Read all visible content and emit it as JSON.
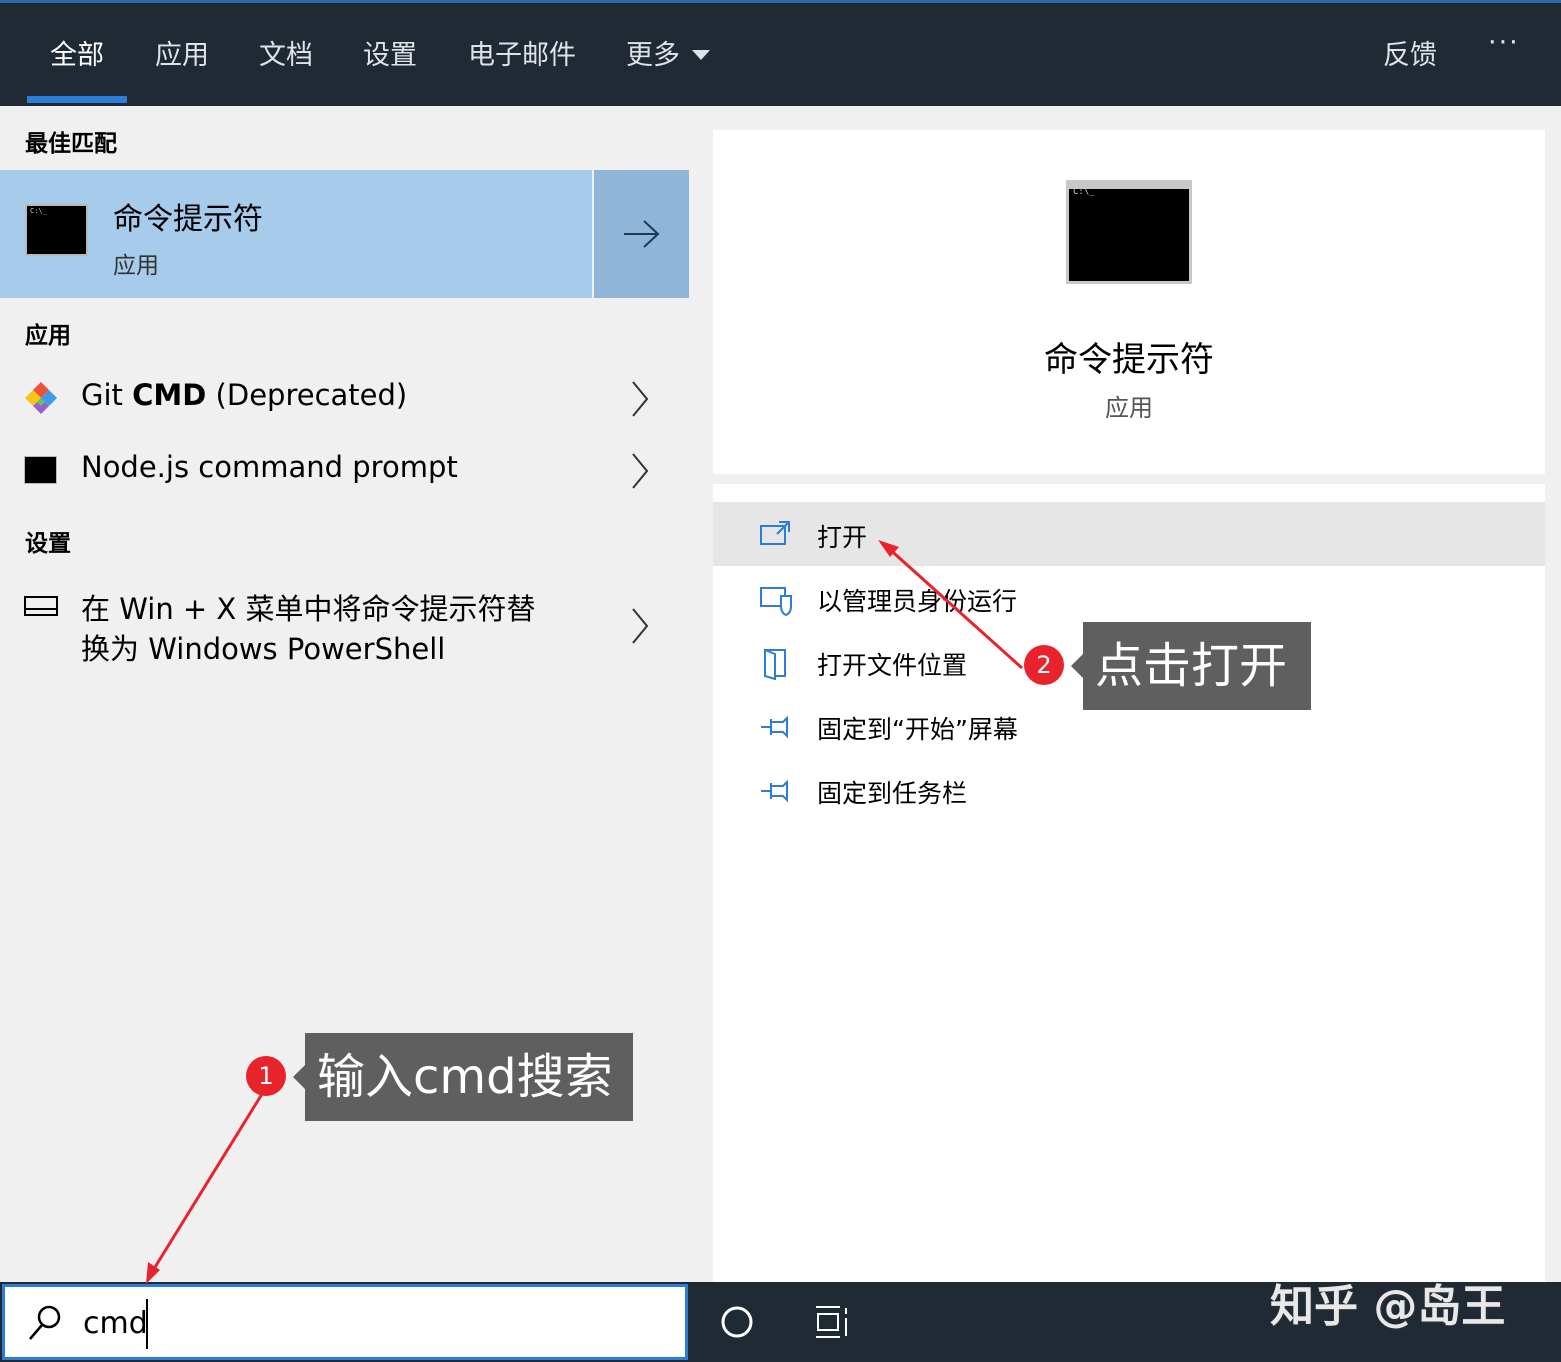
{
  "nav": {
    "tabs": [
      "全部",
      "应用",
      "文档",
      "设置",
      "电子邮件",
      "更多"
    ],
    "feedback": "反馈",
    "more_menu": "···"
  },
  "best_match": {
    "heading": "最佳匹配",
    "title": "命令提示符",
    "subtitle": "应用",
    "icon": "cmd-terminal-icon"
  },
  "apps": {
    "heading": "应用",
    "items": [
      {
        "prefix": "Git ",
        "bold": "CMD",
        "suffix": " (Deprecated)",
        "icon": "git-icon"
      },
      {
        "label": "Node.js command prompt",
        "icon": "cmd-terminal-icon"
      }
    ]
  },
  "settings": {
    "heading": "设置",
    "line1": "在 Win + X 菜单中将命令提示符替",
    "line2": "换为 Windows PowerShell",
    "icon": "taskbar-settings-icon"
  },
  "detail": {
    "title": "命令提示符",
    "subtitle": "应用",
    "actions": [
      {
        "label": "打开",
        "icon": "open-icon"
      },
      {
        "label": "以管理员身份运行",
        "icon": "admin-shield-icon"
      },
      {
        "label": "打开文件位置",
        "icon": "file-location-icon"
      },
      {
        "label": "固定到“开始”屏幕",
        "icon": "pin-icon"
      },
      {
        "label": "固定到任务栏",
        "icon": "pin-icon"
      }
    ]
  },
  "search": {
    "value": "cmd",
    "icon": "search-icon"
  },
  "taskbar": {
    "cortana_icon": "cortana-circle-icon",
    "task_view_icon": "task-view-icon"
  },
  "annotations": {
    "step1_badge": "1",
    "step1_text": "输入cmd搜索",
    "step2_badge": "2",
    "step2_text": "点击打开"
  },
  "watermark": "知乎 @岛王",
  "colors": {
    "accent": "#2d7cd6",
    "topbar": "#1f2a35",
    "selection": "#a7cbea",
    "annotation_red": "#e8232b"
  }
}
